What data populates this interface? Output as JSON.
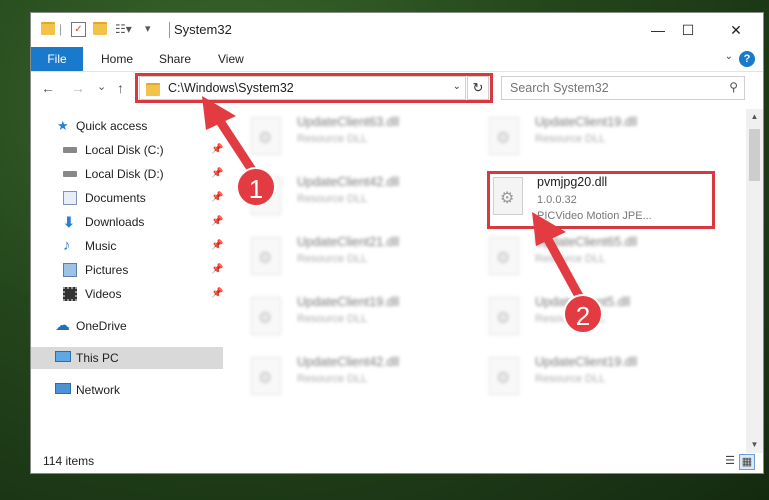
{
  "window": {
    "title": "System32",
    "buttons": {
      "minimize": "—",
      "maximize": "☐",
      "close": "✕"
    }
  },
  "ribbon": {
    "tabs": [
      "File",
      "Home",
      "Share",
      "View"
    ],
    "help": "?"
  },
  "nav": {
    "back": "←",
    "forward": "→",
    "recent": "⌄",
    "up": "↑",
    "address": "C:\\Windows\\System32",
    "search_placeholder": "Search System32"
  },
  "sidebar": {
    "items": [
      {
        "label": "Quick access",
        "icon": "star-icon",
        "pinned": false
      },
      {
        "label": "Local Disk (C:)",
        "icon": "drive-icon",
        "pinned": true
      },
      {
        "label": "Local Disk (D:)",
        "icon": "drive-icon",
        "pinned": true
      },
      {
        "label": "Documents",
        "icon": "documents-icon",
        "pinned": true
      },
      {
        "label": "Downloads",
        "icon": "download-icon",
        "pinned": true
      },
      {
        "label": "Music",
        "icon": "music-icon",
        "pinned": true
      },
      {
        "label": "Pictures",
        "icon": "pictures-icon",
        "pinned": true
      },
      {
        "label": "Videos",
        "icon": "videos-icon",
        "pinned": true
      },
      {
        "label": "OneDrive",
        "icon": "cloud-icon",
        "pinned": false
      },
      {
        "label": "This PC",
        "icon": "computer-icon",
        "pinned": false
      },
      {
        "label": "Network",
        "icon": "network-icon",
        "pinned": false
      }
    ]
  },
  "files": [
    {
      "name": "UpdateClient63.dll",
      "desc": "Resource DLL"
    },
    {
      "name": "UpdateClient19.dll",
      "desc": "Resource DLL"
    },
    {
      "name": "UpdateClient42.dll",
      "desc": "Resource DLL"
    },
    {
      "name": "UpdateClient21.dll",
      "desc": "Resource DLL"
    },
    {
      "name": "UpdateClient65.dll",
      "desc": "Resource DLL"
    },
    {
      "name": "UpdateClient19.dll",
      "desc": "Resource DLL"
    },
    {
      "name": "UpdateClient5.dll",
      "desc": "Resource DLL"
    },
    {
      "name": "UpdateClient42.dll",
      "desc": "Resource DLL"
    },
    {
      "name": "UpdateClient19.dll",
      "desc": "Resource DLL"
    }
  ],
  "highlighted_file": {
    "name": "pvmjpg20.dll",
    "version": "1.0.0.32",
    "desc": "PICVideo Motion JPE..."
  },
  "status": {
    "item_count": "114 items"
  },
  "callouts": {
    "step1": "1",
    "step2": "2"
  },
  "colors": {
    "accent": "#1979ca",
    "highlight": "#d8383f"
  }
}
